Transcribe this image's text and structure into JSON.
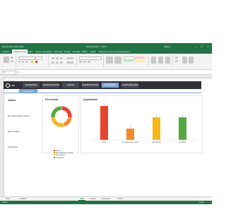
{
  "window": {
    "title_left": "Salvamento automático",
    "title_center": "Modelo PMO — Excel",
    "user": "Rafael"
  },
  "ribbon_tabs": [
    "Arquivo",
    "Página Inicial",
    "Inserir",
    "Layout da Página",
    "Fórmulas",
    "Dados",
    "Revisão",
    "Exibir",
    "Ajuda",
    "Diga-me o que você deseja fazer"
  ],
  "formula_bar": {
    "name_box": "A1",
    "fx": "fx"
  },
  "dashboard": {
    "logo": "LUZ",
    "nav": [
      "DASHBOARD",
      "CADASTRO DE PROJETOS",
      "RISCOS",
      "DASHBOARD RISCOS",
      "FINANCEIRO",
      "CONFIGURAÇÕES"
    ],
    "active_nav_index": 4,
    "subtab": "Dashboard",
    "status_panel": {
      "items": [
        {
          "label": "Atraso",
          "value": "27,27%",
          "color": "#e8432d"
        },
        {
          "label": "Em andamento normal",
          "value": "18,18%",
          "color": "#f4892a"
        },
        {
          "label": "Não iniciado",
          "value": "27,27%",
          "color": "#f6b71b"
        },
        {
          "label": "Concluído",
          "value": "27,27%",
          "color": "#56a840"
        }
      ]
    },
    "donut_panel": {
      "title": "Percentual",
      "legend": [
        "Atraso",
        "Em andamento normal",
        "Não iniciado",
        "Concluído"
      ]
    },
    "bar_panel": {
      "title": "Quantidade"
    }
  },
  "chart_data": [
    {
      "type": "pie",
      "title": "Percentual",
      "labels": [
        "Atraso",
        "Em andamento normal",
        "Não iniciado",
        "Concluído"
      ],
      "values": [
        27.27,
        18.18,
        27.27,
        27.27
      ],
      "colors": [
        "#e8432d",
        "#f4892a",
        "#f6b71b",
        "#56a840"
      ]
    },
    {
      "type": "bar",
      "title": "Quantidade",
      "categories": [
        "Atraso",
        "Em andamento normal",
        "Não iniciado",
        "Concluído"
      ],
      "values": [
        3,
        1,
        2,
        2
      ],
      "colors": [
        "#e8432d",
        "#f4892a",
        "#f6b71b",
        "#56a840"
      ]
    }
  ],
  "sheet_tabs": [
    "Início",
    "Projetos",
    "Dash",
    "Riscos",
    "Financeiro",
    "Config"
  ],
  "active_sheet_index": 2,
  "status_bar": {
    "left": "Pronto",
    "zoom": "100%"
  },
  "colors": {
    "excel_green": "#217346",
    "dash_dark": "#2f3136",
    "accent_blue": "#7ea6d6"
  }
}
